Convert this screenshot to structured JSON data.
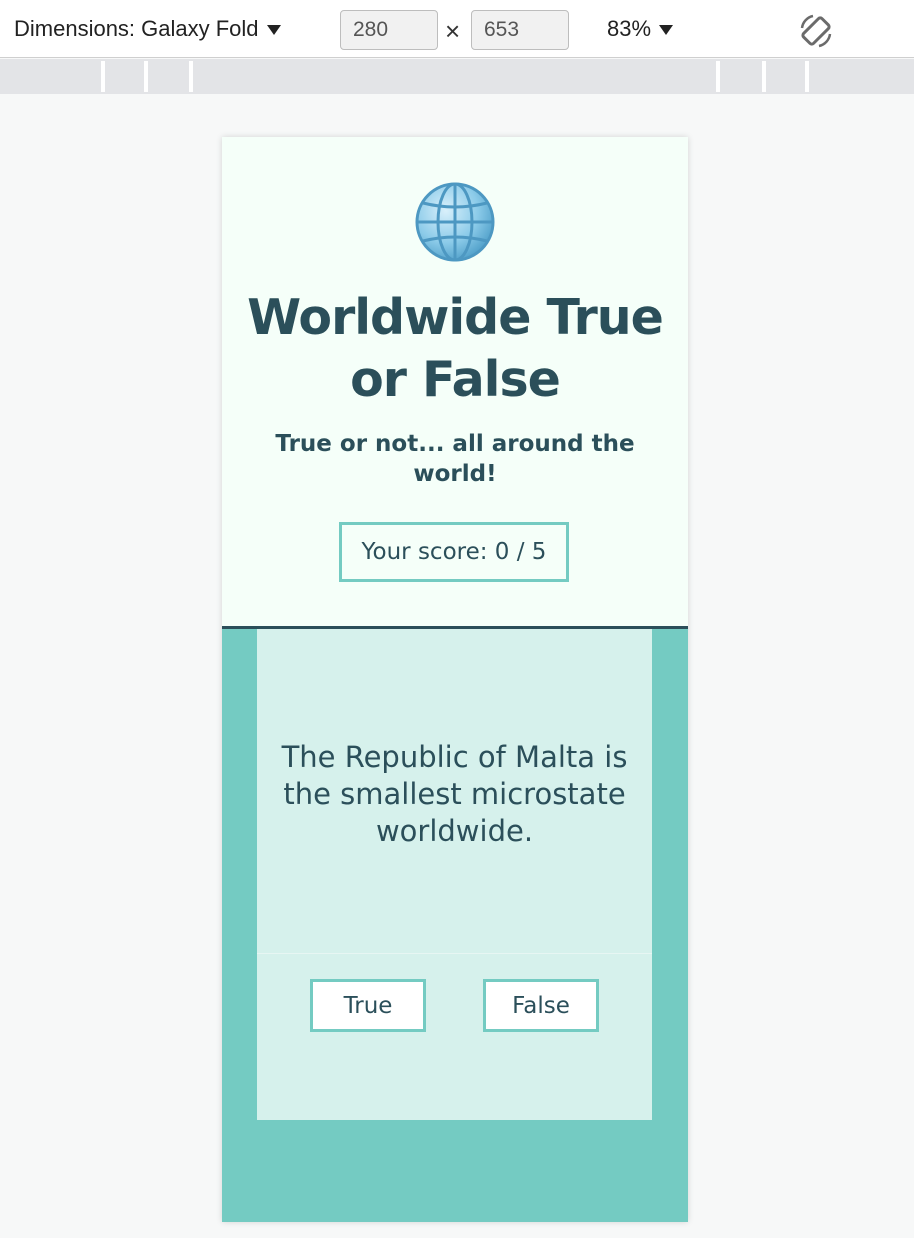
{
  "devtools": {
    "dimensions_label": "Dimensions: Galaxy Fold",
    "width_value": "280",
    "height_value": "653",
    "times_symbol": "×",
    "zoom_label": "83%"
  },
  "quiz": {
    "title": "Worldwide True or False",
    "subtitle": "True or not... all around the world!",
    "score": "Your score: 0 / 5",
    "question": "The Republic of Malta is the smallest microstate worldwide.",
    "true_label": "True",
    "false_label": "False"
  },
  "colors": {
    "dark_teal": "#2b4f5a",
    "accent_teal": "#74cbc2",
    "card_bg": "#d6f1ec",
    "header_bg": "#f5fff9"
  }
}
